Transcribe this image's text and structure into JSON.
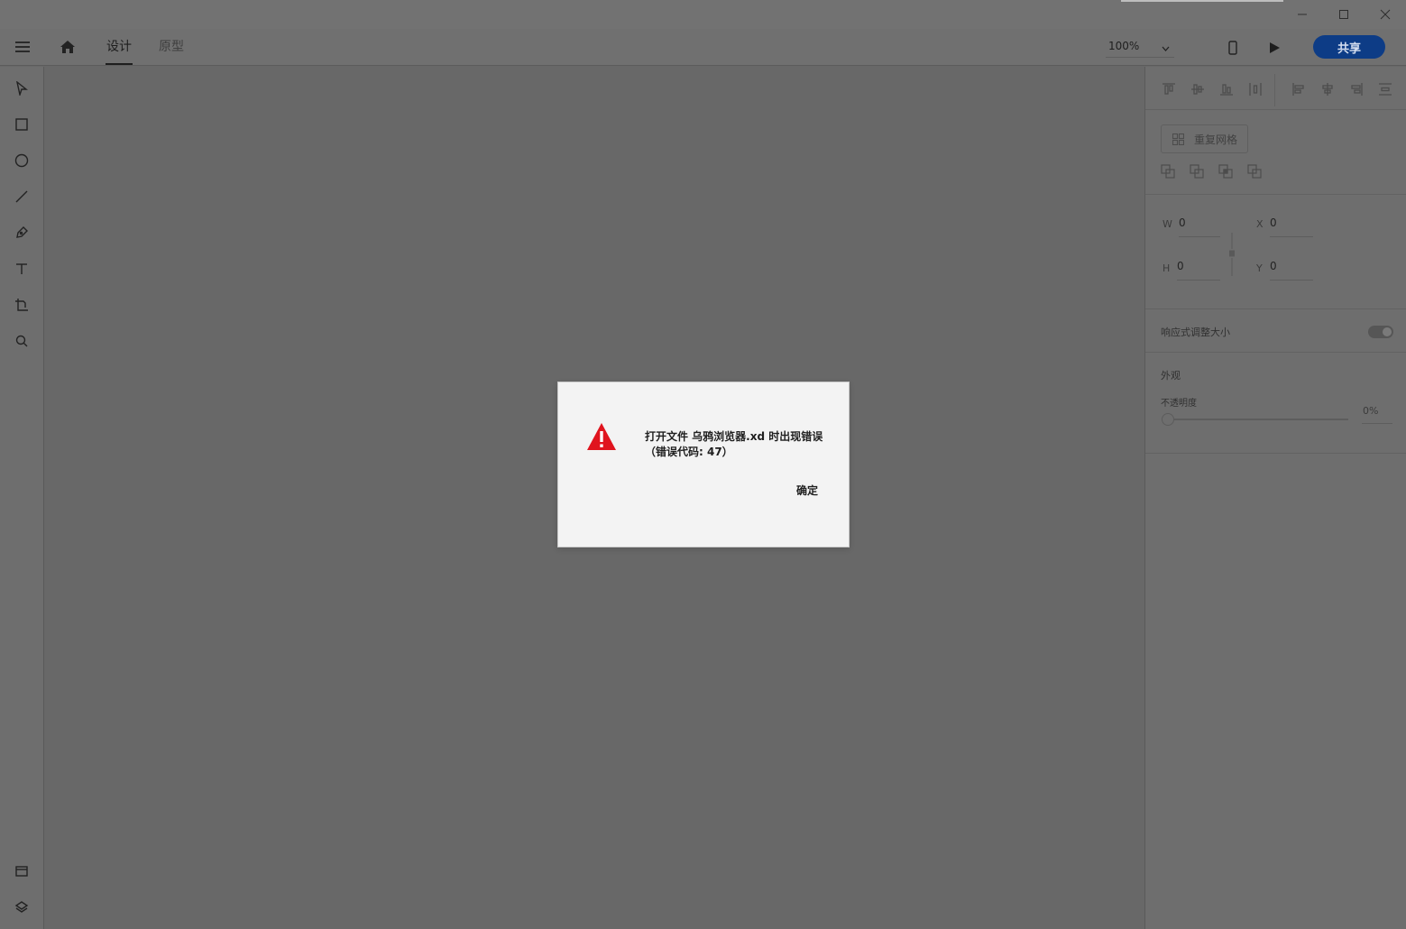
{
  "window": {
    "controls": [
      "minimize-icon",
      "maximize-icon",
      "close-icon"
    ]
  },
  "header": {
    "menu_icon": "hamburger-icon",
    "home_icon": "home-icon",
    "tabs": [
      {
        "label": "设计",
        "active": true
      },
      {
        "label": "原型",
        "active": false
      }
    ],
    "zoom": "100%",
    "preview_device_icon": "phone-icon",
    "play_icon": "play-icon",
    "share_label": "共享",
    "share_color": "#0d3c86"
  },
  "tools": [
    "select-icon",
    "rectangle-icon",
    "ellipse-icon",
    "line-icon",
    "pen-icon",
    "text-icon",
    "artboard-icon",
    "zoom-icon",
    "assets-icon",
    "layers-icon"
  ],
  "panel": {
    "repeat_grid_label": "重复网格",
    "fields": {
      "w_label": "W",
      "w_value": "0",
      "x_label": "X",
      "x_value": "0",
      "h_label": "H",
      "h_value": "0",
      "y_label": "Y",
      "y_value": "0"
    },
    "responsive_resize_label": "响应式调整大小",
    "appearance_label": "外观",
    "opacity_label": "不透明度",
    "opacity_value": "0%"
  },
  "dialog": {
    "line1": "打开文件 乌鸦浏览器.xd 时出现错误",
    "line2": "（错误代码: 47）",
    "ok_label": "确定",
    "icon": "warning-icon",
    "icon_color": "#e0141e"
  }
}
